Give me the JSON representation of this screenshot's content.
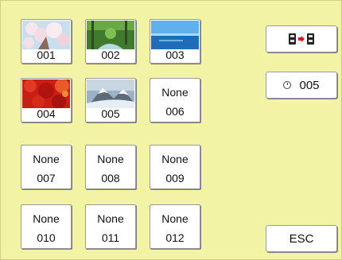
{
  "slots": [
    {
      "num": "001",
      "thumbnail": "cherry-blossom-photo"
    },
    {
      "num": "002",
      "thumbnail": "forest-stream-photo"
    },
    {
      "num": "003",
      "thumbnail": "ocean-sky-photo"
    },
    {
      "num": "004",
      "thumbnail": "red-maple-leaves-photo"
    },
    {
      "num": "005",
      "thumbnail": "snowy-mountain-photo"
    },
    {
      "label": "None",
      "num": "006"
    },
    {
      "label": "None",
      "num": "007"
    },
    {
      "label": "None",
      "num": "008"
    },
    {
      "label": "None",
      "num": "009"
    },
    {
      "label": "None",
      "num": "010"
    },
    {
      "label": "None",
      "num": "011"
    },
    {
      "label": "None",
      "num": "012"
    }
  ],
  "buttons": {
    "transfer_icon": "memory-transfer-icon",
    "selected_slot": "005",
    "selected_icon": "clock-icon",
    "esc": "ESC"
  },
  "colors": {
    "background": "#f3f3a6",
    "slot_face": "#ffffff"
  }
}
